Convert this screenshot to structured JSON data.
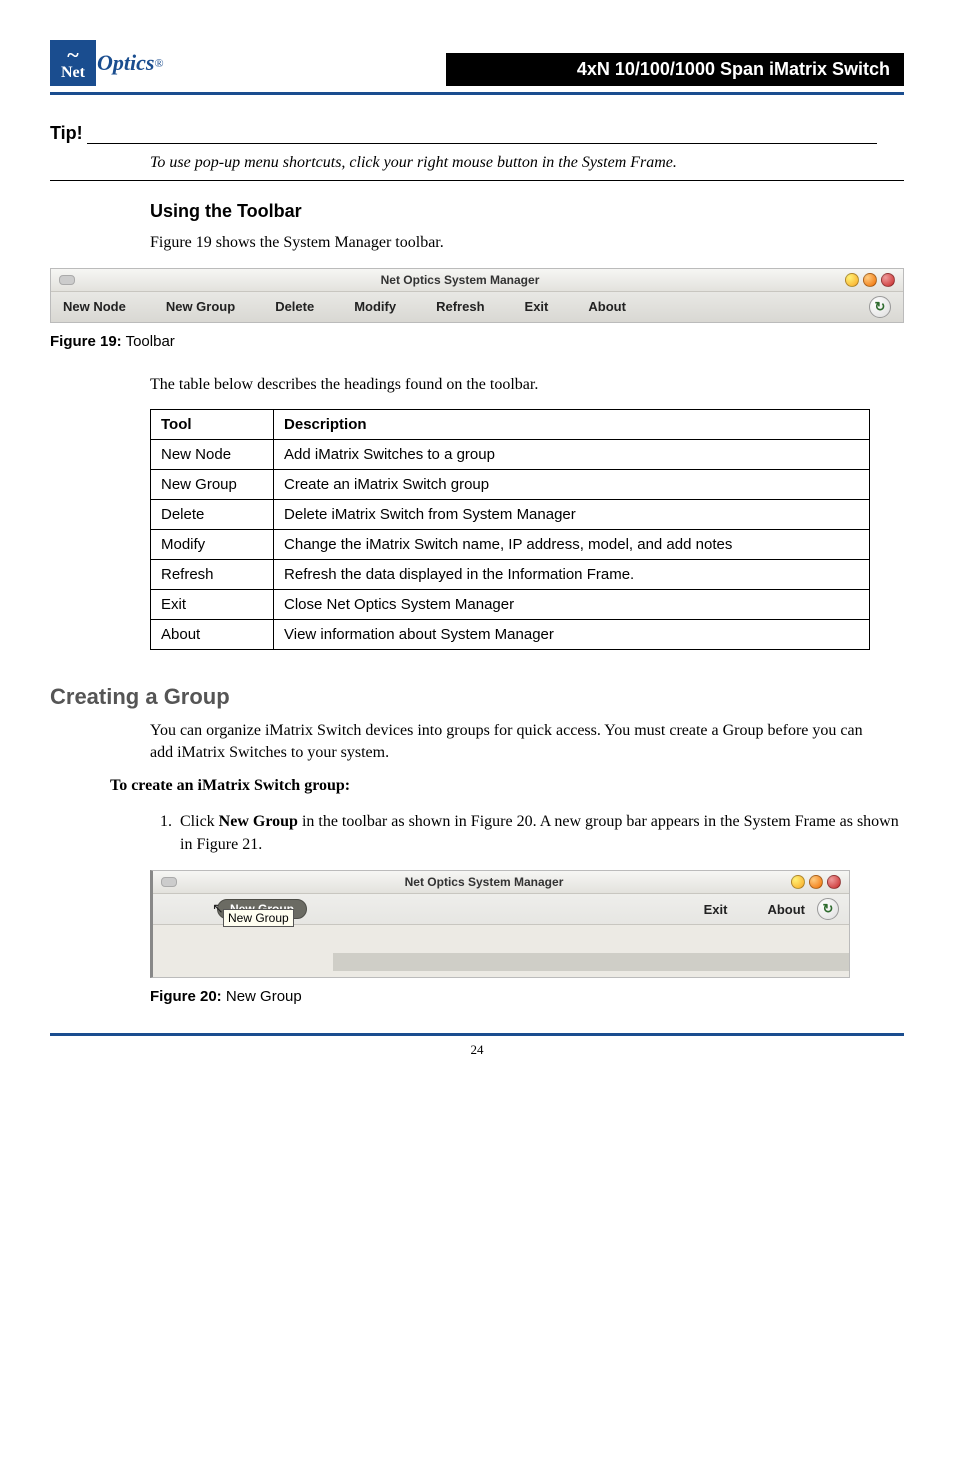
{
  "header": {
    "logo_net": "Net",
    "logo_optics": "Optics",
    "logo_reg": "®",
    "bar_title": "4xN 10/100/1000 Span iMatrix Switch"
  },
  "tip": {
    "label": "Tip!",
    "text": "To use pop-up menu shortcuts, click your right mouse button in the System Frame."
  },
  "section_toolbar": {
    "heading": "Using the Toolbar",
    "intro": "Figure 19 shows the System Manager toolbar."
  },
  "toolbar1": {
    "window_title": "Net Optics System Manager",
    "items": [
      "New Node",
      "New Group",
      "Delete",
      "Modify",
      "Refresh",
      "Exit",
      "About"
    ]
  },
  "figure19": {
    "label": "Figure 19:",
    "caption": " Toolbar"
  },
  "table_intro": "The table below describes the headings found on the toolbar.",
  "tool_table": {
    "head": [
      "Tool",
      "Description"
    ],
    "rows": [
      [
        "New Node",
        "Add iMatrix Switches to a group"
      ],
      [
        "New Group",
        "Create an iMatrix Switch group"
      ],
      [
        "Delete",
        "Delete iMatrix Switch from System Manager"
      ],
      [
        "Modify",
        "Change the iMatrix Switch name, IP address, model, and add notes"
      ],
      [
        "Refresh",
        "Refresh the data displayed in the Information Frame."
      ],
      [
        "Exit",
        "Close Net Optics System Manager"
      ],
      [
        "About",
        "View information about System Manager"
      ]
    ]
  },
  "creating_group": {
    "heading": "Creating a Group",
    "intro": "You can organize iMatrix Switch devices into groups for quick access. You must create a Group before you can add iMatrix Switches to your system.",
    "step_label": "To create an iMatrix Switch group:",
    "step1_pre": "Click ",
    "step1_bold": "New Group",
    "step1_post": " in the toolbar as shown in Figure 20. A new group bar appears in the System Frame as shown in Figure 21."
  },
  "toolbar2": {
    "window_title": "Net Optics System Manager",
    "new_group_btn": "New Group",
    "tooltip": "New Group",
    "exit": "Exit",
    "about": "About"
  },
  "figure20": {
    "label": "Figure 20:",
    "caption": " New Group"
  },
  "page_number": "24"
}
